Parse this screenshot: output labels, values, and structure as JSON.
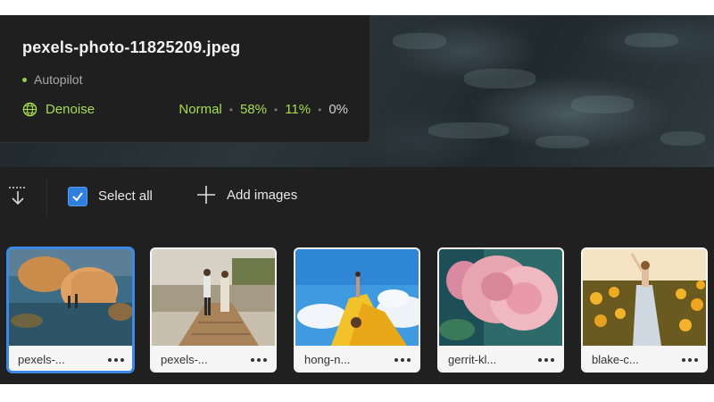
{
  "file": {
    "name": "pexels-photo-11825209.jpeg",
    "mode": "Autopilot",
    "filter_label": "Denoise",
    "levels": [
      "Normal",
      "58%",
      "11%",
      "0%"
    ]
  },
  "toolbar": {
    "select_all_label": "Select all",
    "select_all_checked": true,
    "add_images_label": "Add images"
  },
  "thumbnails": [
    {
      "name": "pexels-...",
      "selected": true,
      "icons": [
        "status-dot",
        "sparkle-icon"
      ]
    },
    {
      "name": "pexels-...",
      "selected": false,
      "icons": [
        "status-dot"
      ]
    },
    {
      "name": "hong-n...",
      "selected": false,
      "icons": [
        "status-dot",
        "sparkle-icon"
      ]
    },
    {
      "name": "gerrit-kl...",
      "selected": false,
      "icons": [
        "status-dot"
      ]
    },
    {
      "name": "blake-c...",
      "selected": false,
      "icons": [
        "status-dot",
        "sparkle-icon"
      ]
    }
  ],
  "colors": {
    "accent_green": "#a6dc50",
    "selection_blue": "#3b8ae8",
    "panel_bg": "#1f1f1f"
  }
}
